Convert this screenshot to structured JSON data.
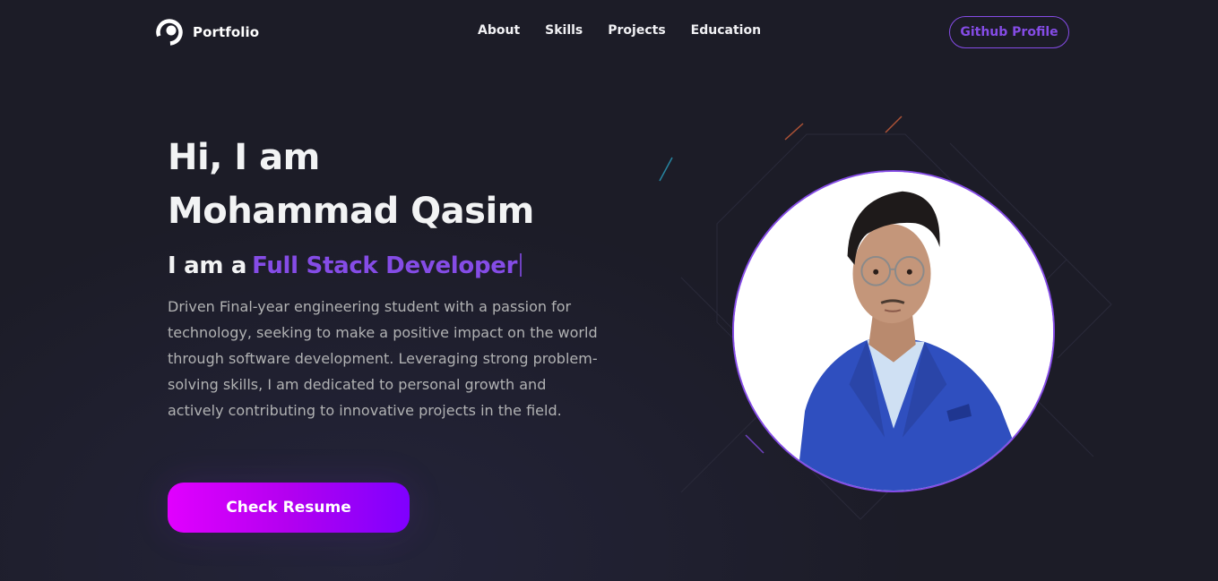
{
  "nav": {
    "logo_text": "Portfolio",
    "links": [
      "About",
      "Skills",
      "Projects",
      "Education"
    ],
    "github_label": "Github Profile"
  },
  "hero": {
    "greeting": "Hi, I am",
    "name": "Mohammad Qasim",
    "role_prefix": "I am a",
    "role": "Full Stack Developer",
    "bio": "Driven Final-year engineering student with a passion for technology, seeking to make a positive impact on the world through software development. Leveraging strong problem-solving skills, I am dedicated to personal growth and actively contributing to innovative projects in the field.",
    "resume_label": "Check Resume"
  },
  "colors": {
    "background": "#1c1c27",
    "accent": "#854ce6",
    "text_primary": "#f2f3f4",
    "text_secondary": "#b1b2b3",
    "button_gradient_start": "#e100ff",
    "button_gradient_end": "#7f00ff"
  },
  "icons": {
    "logo": "ring-logo-icon"
  }
}
